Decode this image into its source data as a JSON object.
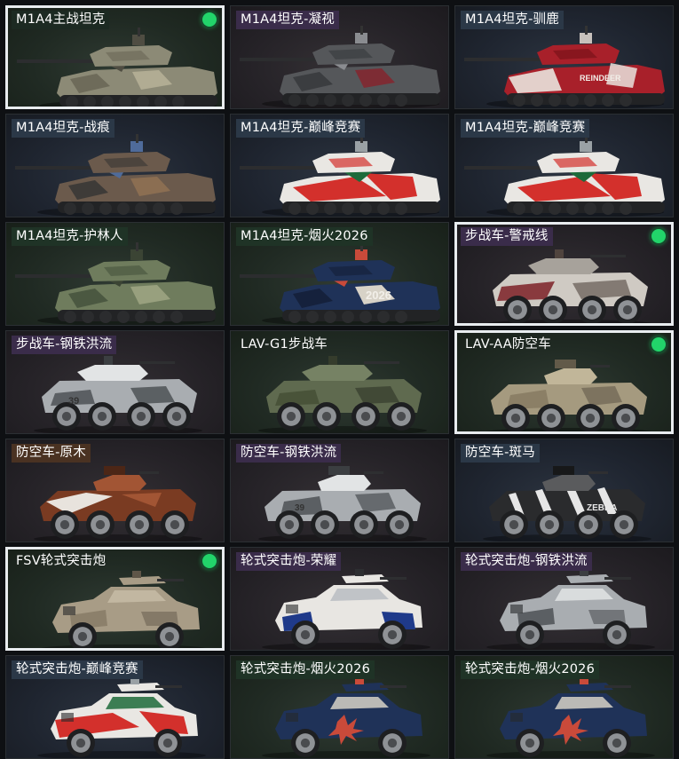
{
  "vehicles": [
    {
      "name": "M1A4主战坦克",
      "kind": "tank",
      "camo": "desert",
      "equipped": true,
      "tag_color": "#1c2a22",
      "bg": "g1"
    },
    {
      "name": "M1A4坦克-凝视",
      "kind": "tank",
      "camo": "gaze",
      "equipped": false,
      "tag_color": "#3a2c4a",
      "bg": "g3"
    },
    {
      "name": "M1A4坦克-驯鹿",
      "kind": "tank",
      "camo": "reindeer",
      "equipped": false,
      "tag_color": "#2b3847",
      "bg": "g2",
      "decal": "REINDEER"
    },
    {
      "name": "M1A4坦克-战痕",
      "kind": "tank",
      "camo": "scar",
      "equipped": false,
      "tag_color": "#2b3847",
      "bg": "g2"
    },
    {
      "name": "M1A4坦克-巅峰竞赛",
      "kind": "tank",
      "camo": "race",
      "equipped": false,
      "tag_color": "#2b3847",
      "bg": "g2"
    },
    {
      "name": "M1A4坦克-巅峰竞赛",
      "kind": "tank",
      "camo": "race",
      "equipped": false,
      "tag_color": "#2b3847",
      "bg": "g2"
    },
    {
      "name": "M1A4坦克-护林人",
      "kind": "tank",
      "camo": "forest",
      "equipped": false,
      "tag_color": "#1f3326",
      "bg": "g1"
    },
    {
      "name": "M1A4坦克-烟火2026",
      "kind": "tank",
      "camo": "firework",
      "equipped": false,
      "tag_color": "#1f3326",
      "bg": "g1",
      "decal": "2026"
    },
    {
      "name": "步战车-警戒线",
      "kind": "ifv",
      "camo": "caution",
      "equipped": true,
      "tag_color": "#3a2c4a",
      "bg": "g3"
    },
    {
      "name": "步战车-钢铁洪流",
      "kind": "ifv",
      "camo": "steel",
      "equipped": false,
      "tag_color": "#3a2c4a",
      "bg": "g3",
      "decal": "39"
    },
    {
      "name": "LAV-G1步战车",
      "kind": "ifv",
      "camo": "olive",
      "equipped": false,
      "tag_color": "",
      "bg": "g1"
    },
    {
      "name": "LAV-AA防空车",
      "kind": "aa",
      "camo": "sand",
      "equipped": true,
      "tag_color": "",
      "bg": "g1"
    },
    {
      "name": "防空车-原木",
      "kind": "aa",
      "camo": "wood",
      "equipped": false,
      "tag_color": "#4a3222",
      "bg": "g3"
    },
    {
      "name": "防空车-钢铁洪流",
      "kind": "aa",
      "camo": "steel",
      "equipped": false,
      "tag_color": "#3a2c4a",
      "bg": "g3",
      "decal": "39"
    },
    {
      "name": "防空车-斑马",
      "kind": "aa",
      "camo": "zebra",
      "equipped": false,
      "tag_color": "#2b3847",
      "bg": "g2",
      "decal": "ZEBRA"
    },
    {
      "name": "FSV轮式突击炮",
      "kind": "fsv",
      "camo": "sandfsv",
      "equipped": true,
      "tag_color": "",
      "bg": "g1"
    },
    {
      "name": "轮式突击炮-荣耀",
      "kind": "fsv",
      "camo": "glory",
      "equipped": false,
      "tag_color": "#3a2c4a",
      "bg": "g3"
    },
    {
      "name": "轮式突击炮-钢铁洪流",
      "kind": "fsv",
      "camo": "steel",
      "equipped": false,
      "tag_color": "#3a2c4a",
      "bg": "g3"
    },
    {
      "name": "轮式突击炮-巅峰竞赛",
      "kind": "fsv",
      "camo": "race",
      "equipped": false,
      "tag_color": "#2b3847",
      "bg": "g2"
    },
    {
      "name": "轮式突击炮-烟火2026",
      "kind": "fsv",
      "camo": "firework",
      "equipped": false,
      "tag_color": "#1f3326",
      "bg": "g1"
    },
    {
      "name": "轮式突击炮-烟火2026",
      "kind": "fsv",
      "camo": "firework",
      "equipped": false,
      "tag_color": "#1f3326",
      "bg": "g1"
    }
  ],
  "colors": {
    "equipped_badge": "#22d46a",
    "selected_border": "#e8ecef",
    "background": "#0e1013"
  }
}
